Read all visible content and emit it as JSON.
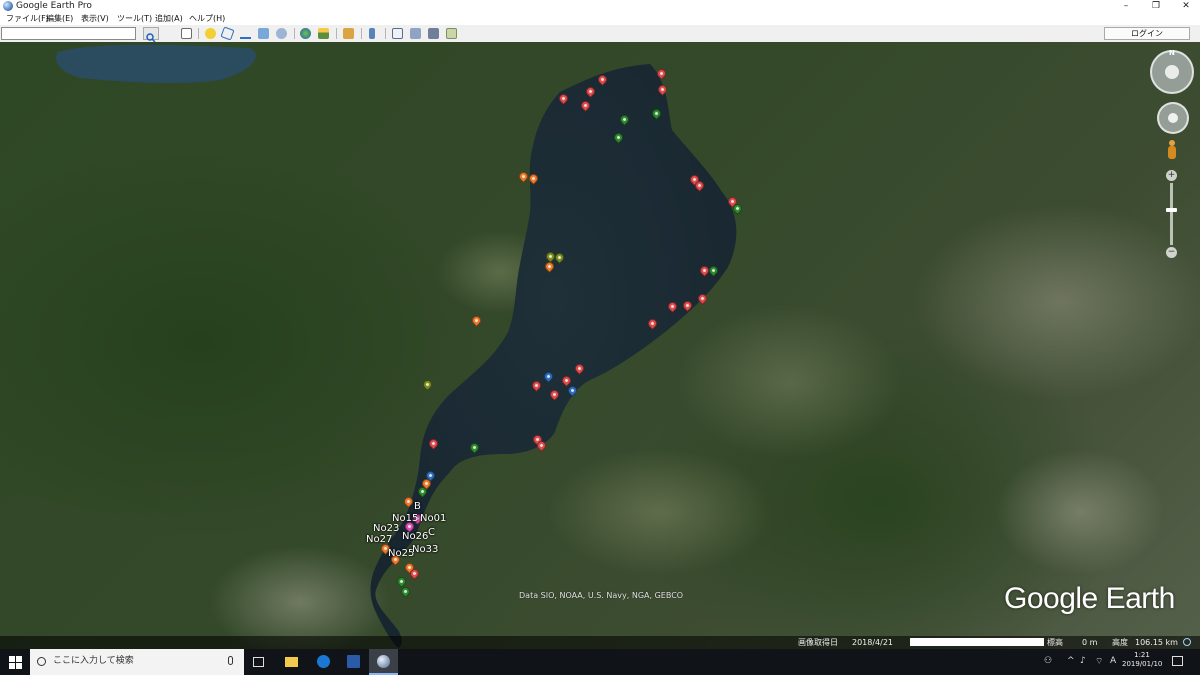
{
  "window": {
    "title": "Google Earth Pro",
    "minimize": "–",
    "maximize": "❐",
    "close": "✕"
  },
  "menu": [
    "ファイル(F)",
    "編集(E)",
    "表示(V)",
    "ツール(T)",
    "追加(A)",
    "ヘルプ(H)"
  ],
  "toolbar": {
    "search_value": "",
    "login_label": "ログイン",
    "icons": [
      "search-icon",
      "sidebar-icon",
      "placemark-icon",
      "polygon-icon",
      "path-icon",
      "overlay-icon",
      "tour-icon",
      "sky-icon",
      "sunlight-icon",
      "ruler-icon",
      "email-icon",
      "print-icon",
      "save-image-icon",
      "maps-icon"
    ]
  },
  "map": {
    "labels": [
      "B",
      "No15",
      "No01",
      "No23",
      "C",
      "No27",
      "No26",
      "No25",
      "No33"
    ],
    "attribution": "Data SIO, NOAA, U.S. Navy, NGA, GEBCO",
    "logo": "Google Earth",
    "compass_letter": "N",
    "zoom_in": "+",
    "zoom_out": "−",
    "pins": {
      "red": "#e14b4b",
      "orange": "#ee7a2a",
      "green": "#2e8b2e",
      "olive": "#7a8f1f",
      "blue": "#2f6fc0",
      "pink": "#e04fb2"
    }
  },
  "status": {
    "imagery_date_label": "画像取得日",
    "imagery_date": "2018/4/21",
    "elevation_label": "標高",
    "elevation_value": "0 m",
    "eye_alt_label": "高度",
    "eye_alt_value": "106.15 km"
  },
  "taskbar": {
    "search_placeholder": "ここに入力して検索",
    "time": "1:21",
    "date": "2019/01/10",
    "ime": "A",
    "apps": [
      "task-view-icon",
      "file-explorer-icon",
      "edge-icon",
      "word-icon",
      "google-earth-icon"
    ]
  }
}
